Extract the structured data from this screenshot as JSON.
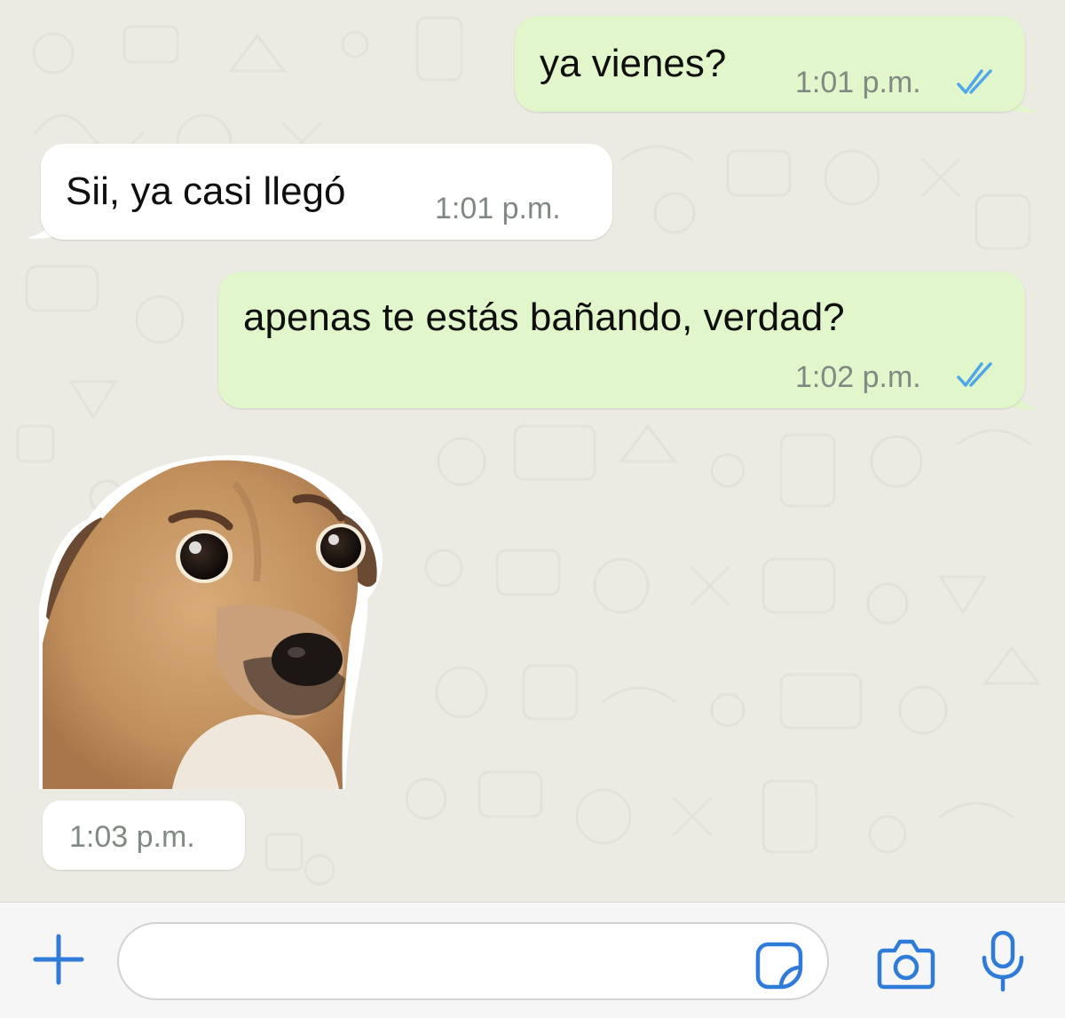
{
  "colors": {
    "outgoing_bubble": "#e1f7cb",
    "incoming_bubble": "#ffffff",
    "read_ticks": "#4fa6e8",
    "accent_icons": "#2f7bd9",
    "chat_background": "#ecebe3"
  },
  "messages": [
    {
      "direction": "outgoing",
      "text": "ya vienes?",
      "time": "1:01 p.m.",
      "status": "read"
    },
    {
      "direction": "incoming",
      "text": "Sii, ya casi llegó",
      "time": "1:01 p.m."
    },
    {
      "direction": "outgoing",
      "text": "apenas te estás bañando, verdad?",
      "time": "1:02 p.m.",
      "status": "read"
    },
    {
      "direction": "incoming",
      "type": "sticker",
      "sticker": "worried-dog-sticker",
      "time": "1:03 p.m."
    }
  ],
  "input_bar": {
    "message_value": "",
    "icons": [
      "plus-icon",
      "sticker-icon",
      "camera-icon",
      "microphone-icon"
    ]
  }
}
